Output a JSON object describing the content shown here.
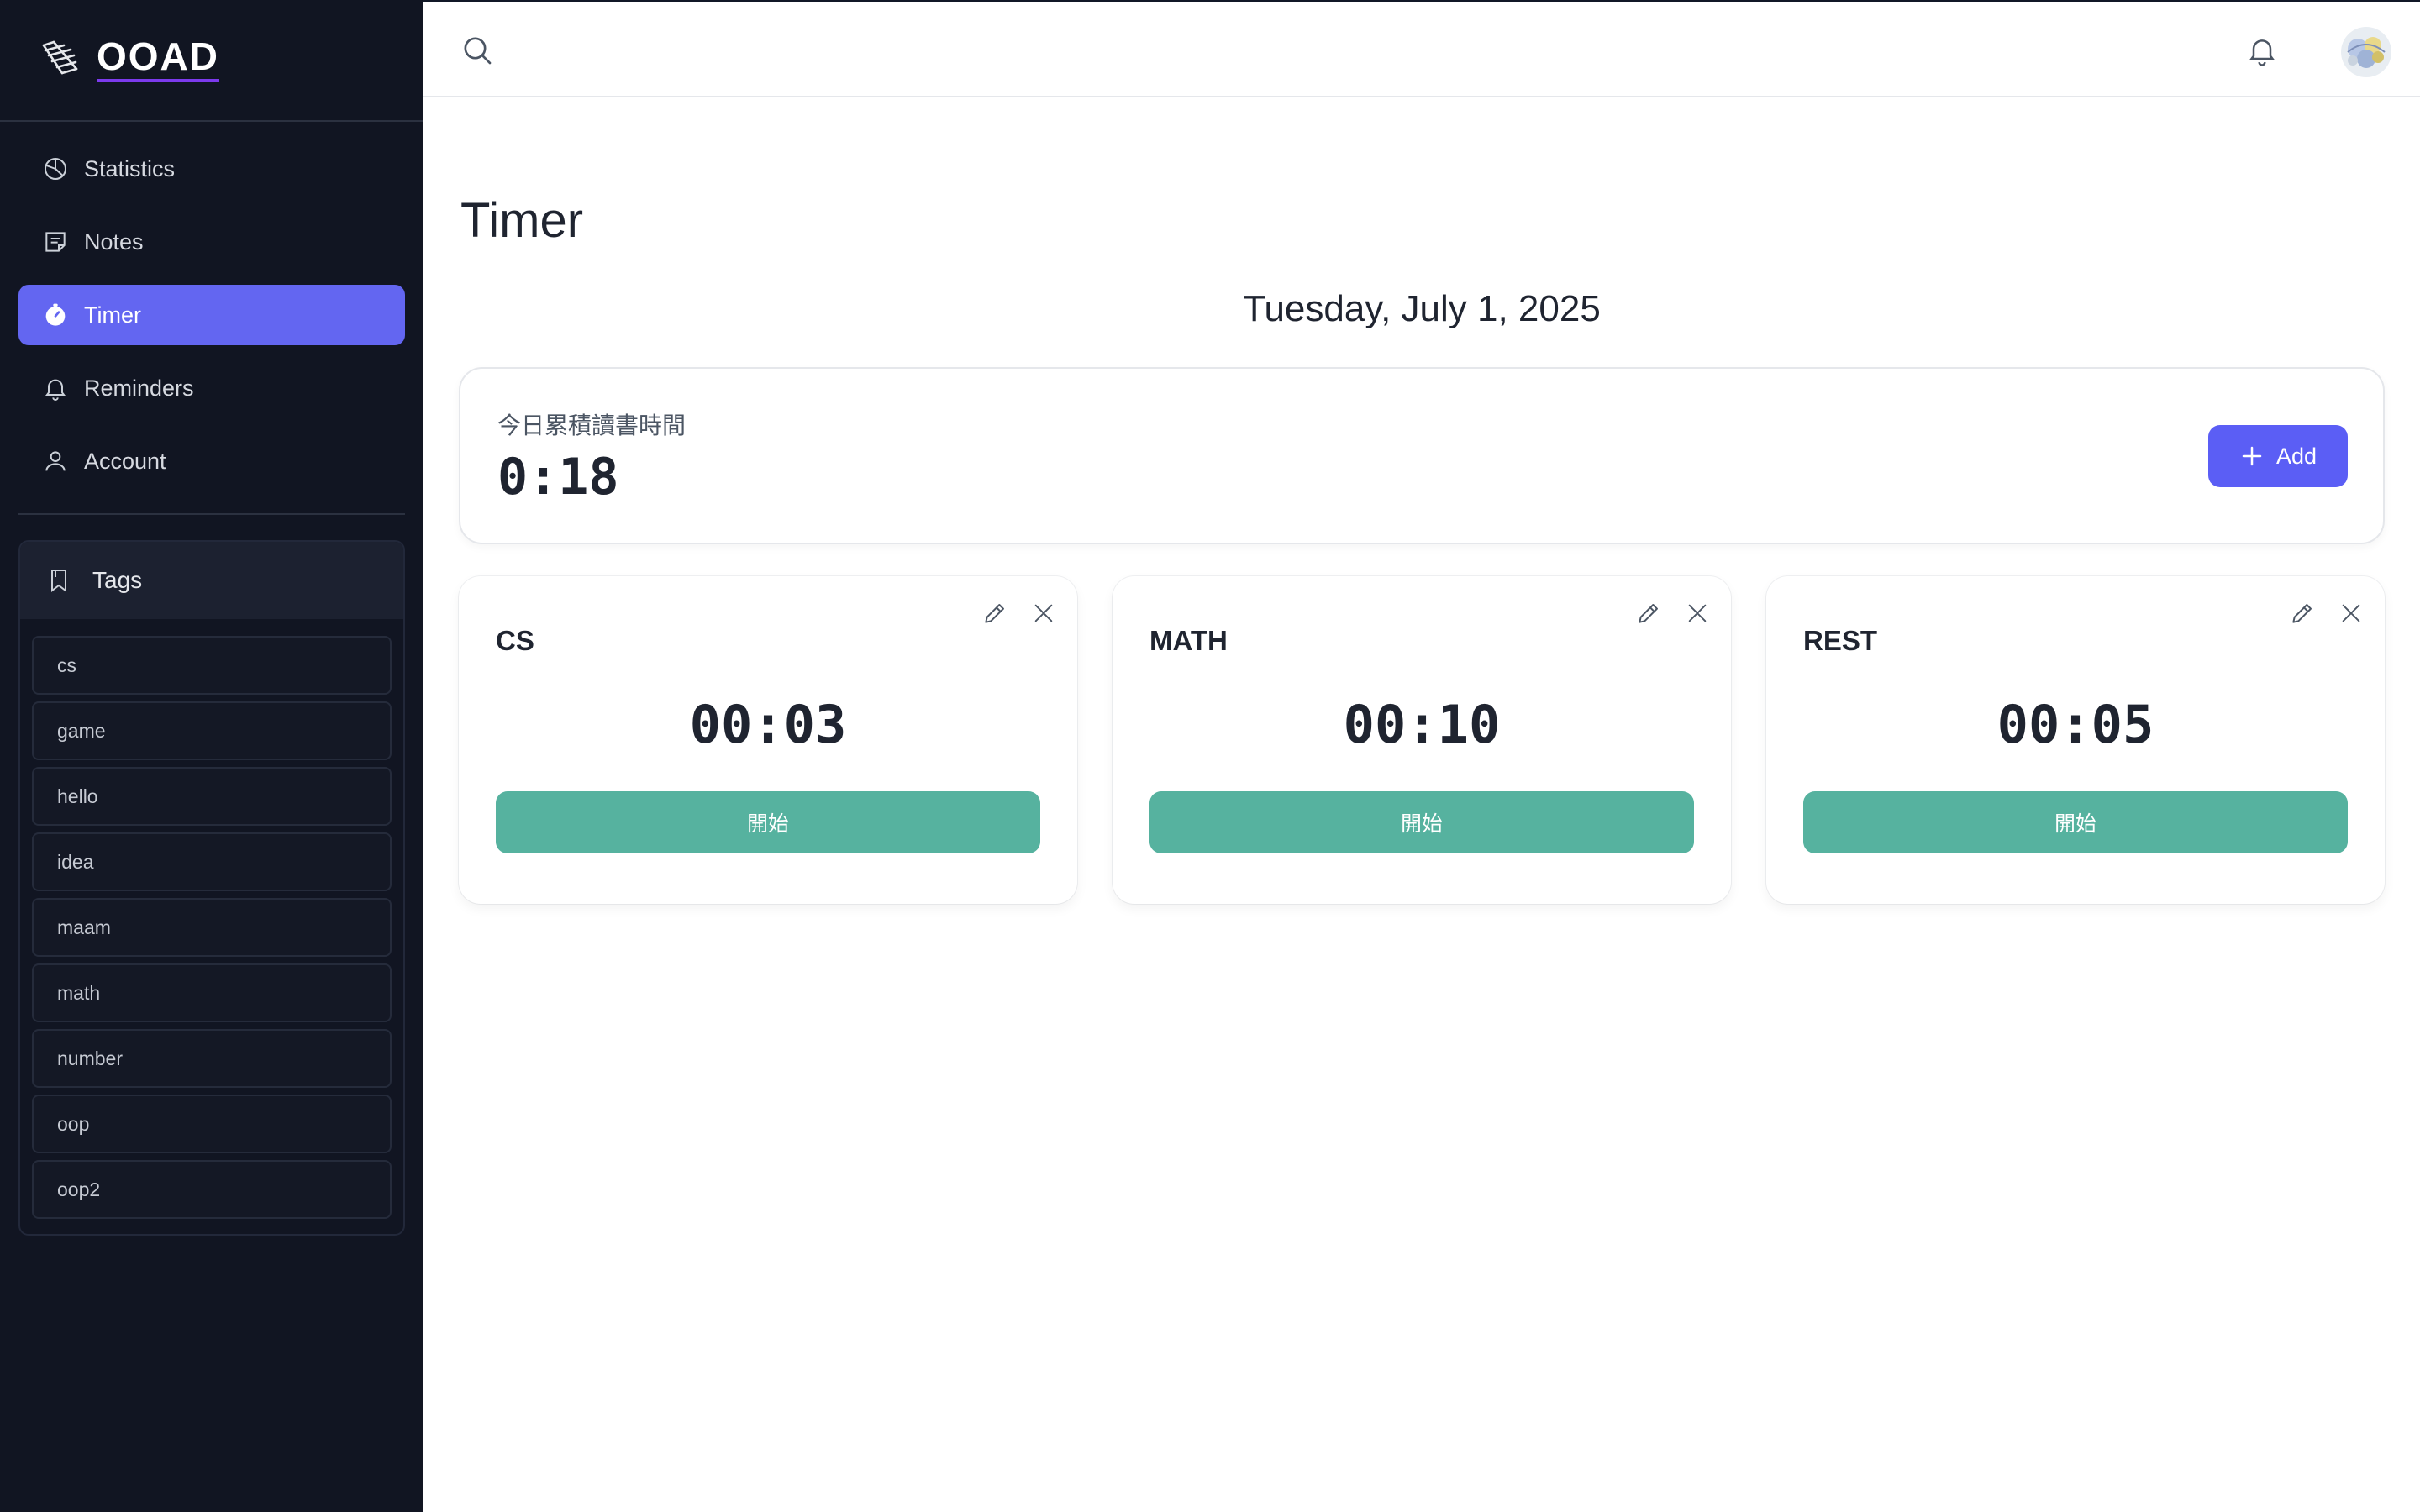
{
  "brand": {
    "name": "OOAD",
    "logo_icon": "pencil-stripes-icon"
  },
  "sidebar": {
    "items": [
      {
        "label": "Statistics",
        "icon": "pie-chart-icon"
      },
      {
        "label": "Notes",
        "icon": "note-icon"
      },
      {
        "label": "Timer",
        "icon": "stopwatch-icon",
        "active": true
      },
      {
        "label": "Reminders",
        "icon": "bell-icon"
      },
      {
        "label": "Account",
        "icon": "user-icon"
      }
    ],
    "tags_title": "Tags",
    "tags": [
      "cs",
      "game",
      "hello",
      "idea",
      "maam",
      "math",
      "number",
      "oop",
      "oop2"
    ]
  },
  "topbar": {
    "search_icon": "search-icon",
    "notification_icon": "bell-icon",
    "avatar": "user-avatar"
  },
  "page": {
    "title": "Timer",
    "date": "Tuesday, July 1, 2025"
  },
  "summary": {
    "label": "今日累積讀書時間",
    "value": "0:18",
    "add_label": "Add"
  },
  "timers": [
    {
      "title": "CS",
      "time": "00:03",
      "start_label": "開始"
    },
    {
      "title": "MATH",
      "time": "00:10",
      "start_label": "開始"
    },
    {
      "title": "REST",
      "time": "00:05",
      "start_label": "開始"
    }
  ],
  "colors": {
    "sidebar_bg": "#111522",
    "accent": "#6366f1",
    "start_button": "#56b29f",
    "brand_underline": "#7c3aed"
  }
}
